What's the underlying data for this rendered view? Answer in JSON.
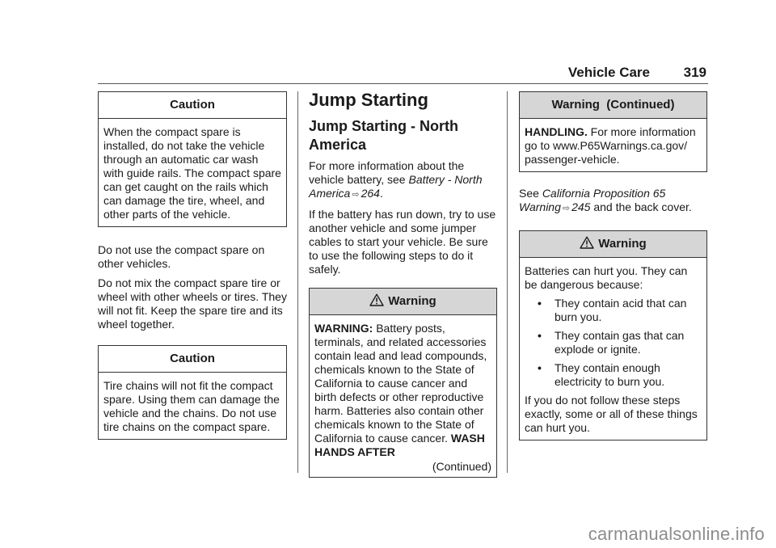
{
  "header": {
    "title": "Vehicle Care",
    "page_number": "319"
  },
  "column1": {
    "caution1": {
      "heading": "Caution",
      "body": "When the compact spare is installed, do not take the vehicle through an automatic car wash with guide rails. The compact spare can get caught on the rails which can damage the tire, wheel, and other parts of the vehicle."
    },
    "paragraphs": [
      "Do not use the compact spare on other vehicles.",
      "Do not mix the compact spare tire or wheel with other wheels or tires. They will not fit. Keep the spare tire and its wheel together."
    ],
    "caution2": {
      "heading": "Caution",
      "body": "Tire chains will not fit the compact spare. Using them can damage the vehicle and the chains. Do not use tire chains on the compact spare."
    }
  },
  "column2": {
    "section_title": "Jump Starting",
    "subsection_title": "Jump Starting - North America",
    "para1": {
      "text_before": "For more information about the vehicle battery, see ",
      "xref_title": "Battery - North America",
      "xref_arrow": "⇨",
      "xref_page": "264",
      "text_after": "."
    },
    "para2": "If the battery has run down, try to use another vehicle and some jumper cables to start your vehicle. Be sure to use the following steps to do it safely.",
    "warning": {
      "icon": "warning-triangle-icon",
      "heading": "Warning",
      "lead_bold": "WARNING:",
      "body": " Battery posts, terminals, and related accessories contain lead and lead compounds, chemicals known to the State of California to cause cancer and birth defects or other reproductive harm. Batteries also contain other chemicals known to the State of California to cause cancer. ",
      "tail_bold": "WASH HANDS AFTER",
      "continued": "(Continued)"
    }
  },
  "column3": {
    "warning_continued": {
      "heading": "Warning  (Continued)",
      "lead_bold": "HANDLING.",
      "body": " For more information go to www.P65Warnings.ca.gov/ passenger-vehicle."
    },
    "see_para": {
      "text_before": "See ",
      "xref_title": "California Proposition 65 Warning",
      "xref_arrow": "⇨",
      "xref_page": "245",
      "text_after": " and the back cover."
    },
    "warning2": {
      "icon": "warning-triangle-icon",
      "heading": "Warning",
      "intro": "Batteries can hurt you. They can be dangerous because:",
      "bullet_glyph": "•",
      "bullets": [
        "They contain acid that can burn you.",
        "They contain gas that can explode or ignite.",
        "They contain enough electricity to burn you."
      ],
      "closing": "If you do not follow these steps exactly, some or all of these things can hurt you."
    }
  },
  "watermark": "carmanualsonline.info"
}
